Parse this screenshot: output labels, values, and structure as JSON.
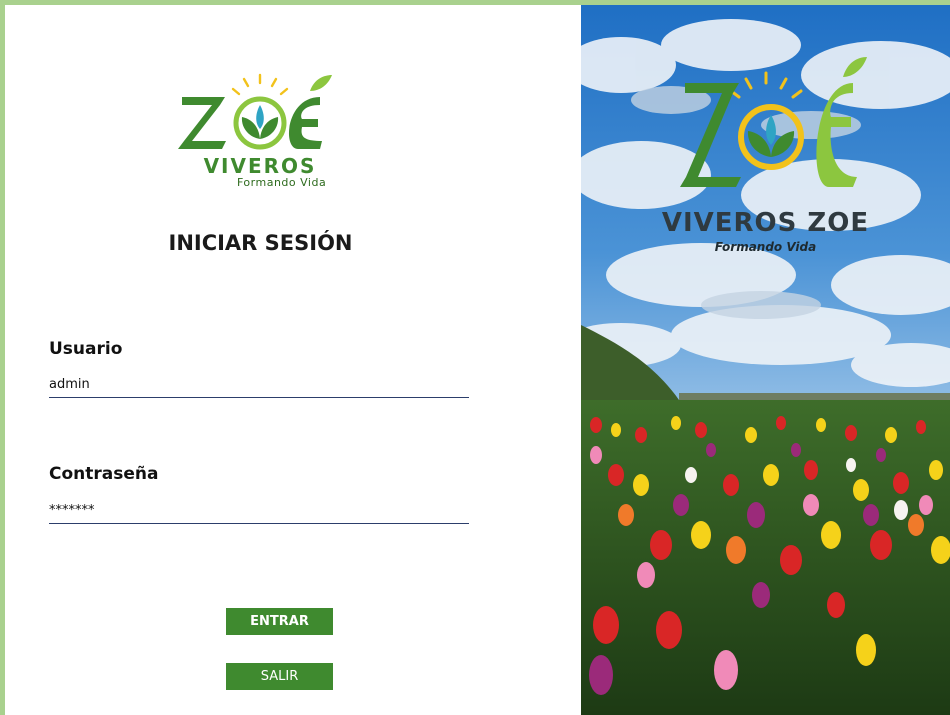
{
  "login": {
    "logo_top": "ZOÉ",
    "logo_bottom": "VIVEROS",
    "logo_tagline": "Formando Vida",
    "title": "INICIAR SESIÓN",
    "username_label": "Usuario",
    "username_value": "admin",
    "password_label": "Contraseña",
    "password_value": "*******",
    "enter_button": "ENTRAR",
    "exit_button": "SALIR"
  },
  "banner": {
    "logo_text": "ZOÉ",
    "brand_name": "VIVEROS ZOE",
    "tagline": "Formando Vida"
  },
  "colors": {
    "frame": "#a9d18e",
    "button": "#3f8a2f",
    "logo_green": "#3f8a2f",
    "logo_light_green": "#8cc63f",
    "sun": "#f2c21b",
    "input_underline": "#2c3e6b"
  }
}
